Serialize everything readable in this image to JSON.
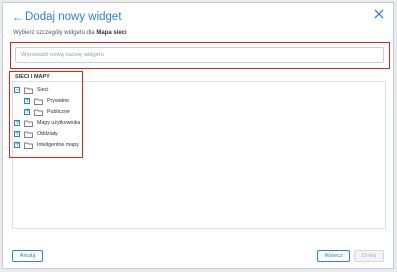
{
  "header": {
    "title": "Dodaj nowy widget",
    "back_icon": "arrow-left-icon",
    "close_icon": "close-icon"
  },
  "subtitle": {
    "text": "Wybierz szczegóły widgetu dla",
    "target": "Mapa sieci"
  },
  "name_input": {
    "value": "",
    "placeholder": "Wprowadź nową nazwę widgetu"
  },
  "tree": {
    "section_label": "SIECI I MAPY",
    "nodes": [
      {
        "label": "Sieci",
        "toggle": "−",
        "level": 0
      },
      {
        "label": "Prywatne",
        "toggle": "+",
        "level": 1
      },
      {
        "label": "Publiczne",
        "toggle": "+",
        "level": 1
      },
      {
        "label": "Mapy użytkownika",
        "toggle": "+",
        "level": 0
      },
      {
        "label": "Oddziały",
        "toggle": "+",
        "level": 0
      },
      {
        "label": "Inteligentne mapy",
        "toggle": "+",
        "level": 0
      }
    ]
  },
  "footer": {
    "cancel_label": "Anuluj",
    "back_label": "Wstecz",
    "add_label": "Dodaj"
  },
  "colors": {
    "accent": "#2f7fd8",
    "highlight": "#d9241c"
  }
}
